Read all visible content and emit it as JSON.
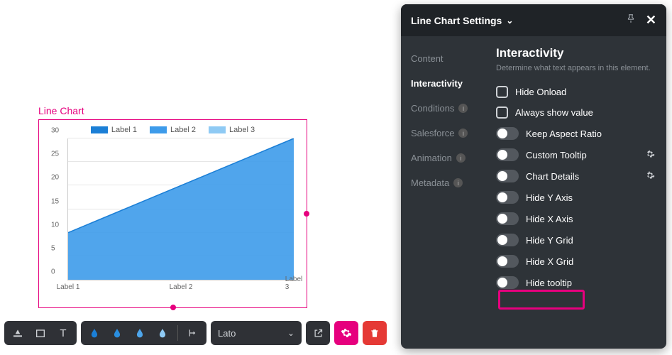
{
  "chart": {
    "title": "Line Chart",
    "legend": [
      "Label 1",
      "Label 2",
      "Label 3"
    ]
  },
  "chart_data": {
    "type": "area",
    "categories": [
      "Label 1",
      "Label 2",
      "Label 3"
    ],
    "series": [
      {
        "name": "Label 1",
        "values": [
          10,
          20,
          30
        ],
        "color": "#3d9bea"
      }
    ],
    "title": "",
    "xlabel": "",
    "ylabel": "",
    "ylim": [
      0,
      30
    ],
    "yticks": [
      0,
      5,
      10,
      15,
      20,
      25,
      30
    ],
    "grid_y": true
  },
  "toolbar": {
    "font": "Lato"
  },
  "panel": {
    "title": "Line Chart Settings",
    "sidebar": [
      {
        "label": "Content",
        "info": false,
        "active": false
      },
      {
        "label": "Interactivity",
        "info": false,
        "active": true
      },
      {
        "label": "Conditions",
        "info": true,
        "active": false
      },
      {
        "label": "Salesforce",
        "info": true,
        "active": false
      },
      {
        "label": "Animation",
        "info": true,
        "active": false
      },
      {
        "label": "Metadata",
        "info": true,
        "active": false
      }
    ],
    "section": {
      "heading": "Interactivity",
      "sub": "Determine what text appears in this element."
    },
    "checkboxes": [
      {
        "label": "Hide Onload"
      },
      {
        "label": "Always show value"
      }
    ],
    "toggles": [
      {
        "label": "Keep Aspect Ratio",
        "gear": false
      },
      {
        "label": "Custom Tooltip",
        "gear": true
      },
      {
        "label": "Chart Details",
        "gear": true
      },
      {
        "label": "Hide Y Axis",
        "gear": false
      },
      {
        "label": "Hide X Axis",
        "gear": false
      },
      {
        "label": "Hide Y Grid",
        "gear": false
      },
      {
        "label": "Hide X Grid",
        "gear": false
      },
      {
        "label": "Hide tooltip",
        "gear": false
      }
    ]
  },
  "colors": {
    "swatch1": "#1b7fd6",
    "swatch2": "#3d9bea",
    "swatch3": "#8fcaf4",
    "accent": "#e6007e"
  }
}
